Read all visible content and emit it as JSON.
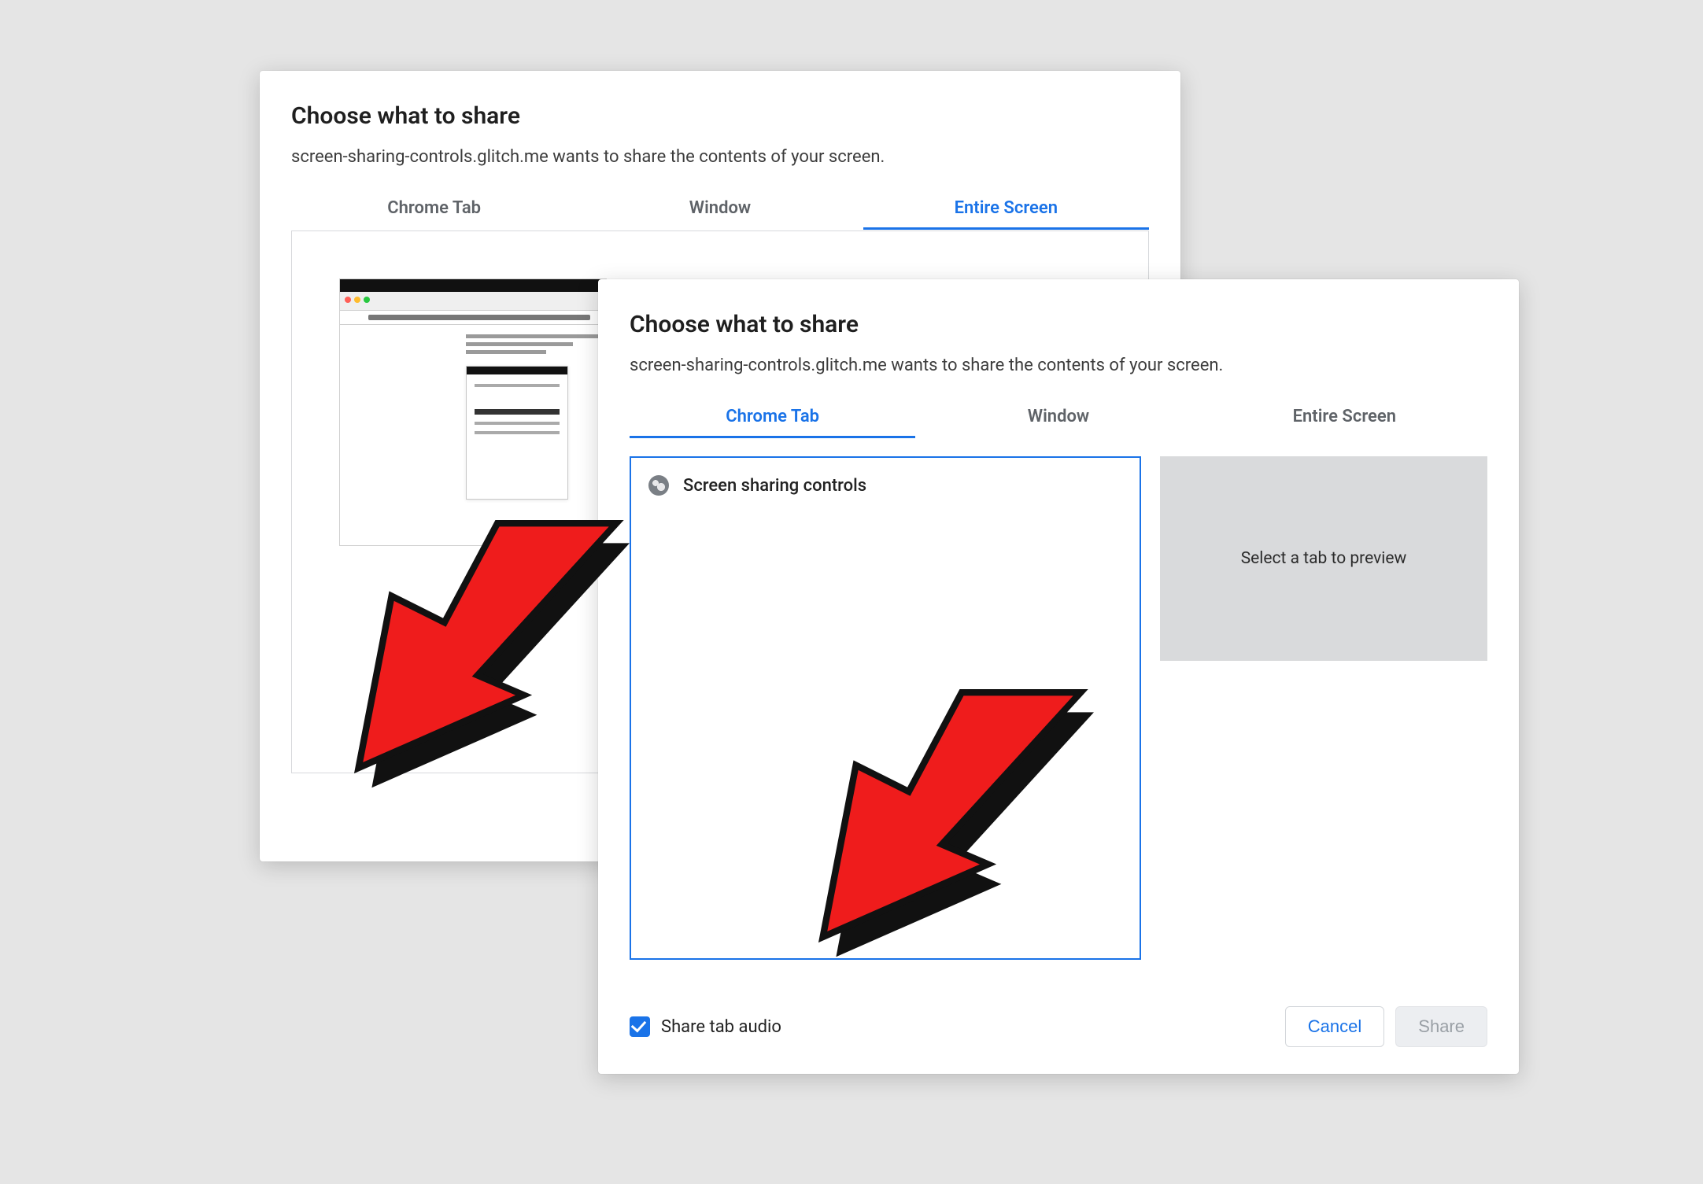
{
  "colors": {
    "accent": "#1a73e8"
  },
  "back_dialog": {
    "title": "Choose what to share",
    "subtitle": "screen-sharing-controls.glitch.me wants to share the contents of your screen.",
    "tabs": [
      {
        "label": "Chrome Tab",
        "active": false
      },
      {
        "label": "Window",
        "active": false
      },
      {
        "label": "Entire Screen",
        "active": true
      }
    ]
  },
  "front_dialog": {
    "title": "Choose what to share",
    "subtitle": "screen-sharing-controls.glitch.me wants to share the contents of your screen.",
    "tabs": [
      {
        "label": "Chrome Tab",
        "active": true
      },
      {
        "label": "Window",
        "active": false
      },
      {
        "label": "Entire Screen",
        "active": false
      }
    ],
    "tab_items": [
      {
        "icon": "globe-icon",
        "label": "Screen sharing controls"
      }
    ],
    "preview_placeholder": "Select a tab to preview",
    "share_audio_label": "Share tab audio",
    "share_audio_checked": true,
    "buttons": {
      "cancel": "Cancel",
      "share": "Share"
    }
  }
}
